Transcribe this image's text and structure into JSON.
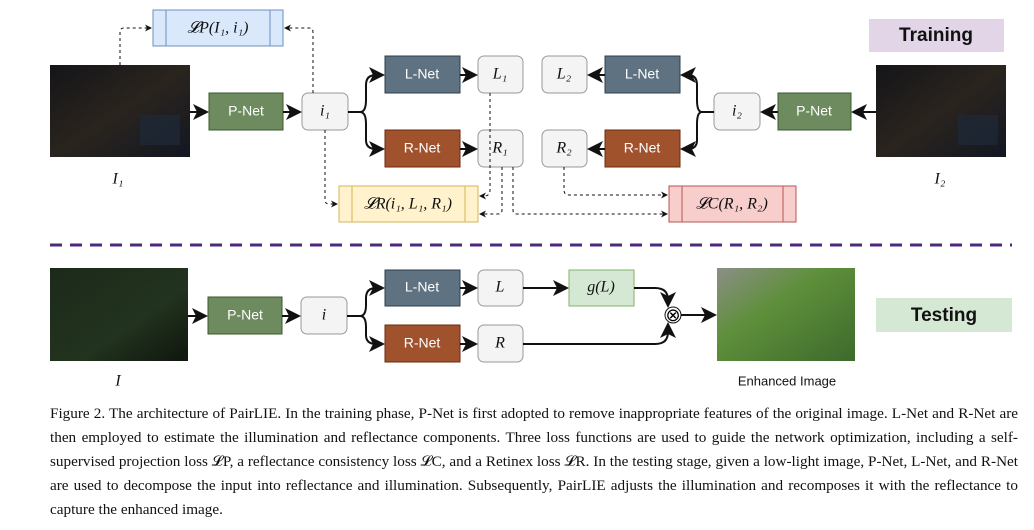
{
  "training": {
    "label": "Training",
    "input1": "I₁",
    "input2": "I₂",
    "pnet": "P-Net",
    "lnet": "L-Net",
    "rnet": "R-Net",
    "i1": "i₁",
    "i2": "i₂",
    "L1": "L₁",
    "R1": "R₁",
    "L2": "L₂",
    "R2": "R₂",
    "loss_p": "𝓛P(I₁, i₁)",
    "loss_r": "𝓛R(i₁, L₁, R₁)",
    "loss_c": "𝓛C(R₁, R₂)"
  },
  "testing": {
    "label": "Testing",
    "input": "I",
    "pnet": "P-Net",
    "lnet": "L-Net",
    "rnet": "R-Net",
    "i": "i",
    "L": "L",
    "R": "R",
    "g": "g(L)",
    "multiply": "⊗",
    "output": "Enhanced Image"
  },
  "colors": {
    "pnet": "#6d8b5e",
    "lnet": "#5f7282",
    "rnet": "#a0522d",
    "loss_p": "#dae8fc",
    "loss_r": "#fff2cc",
    "loss_c": "#f8cecc",
    "training_bg": "#e1d5e7",
    "testing_bg": "#d5e8d4",
    "divider": "#4b2a7f"
  },
  "caption": "Figure 2. The architecture of PairLIE. In the training phase, P-Net is first adopted to remove inappropriate features of the original image. L-Net and R-Net are then employed to estimate the illumination and reflectance components. Three loss functions are used to guide the network optimization, including a self-supervised projection loss 𝓛P, a reflectance consistency loss 𝓛C, and a Retinex loss 𝓛R. In the testing stage, given a low-light image, P-Net, L-Net, and R-Net are used to decompose the input into reflectance and illumination. Subsequently, PairLIE adjusts the illumination and recomposes it with the reflectance to capture the enhanced image."
}
